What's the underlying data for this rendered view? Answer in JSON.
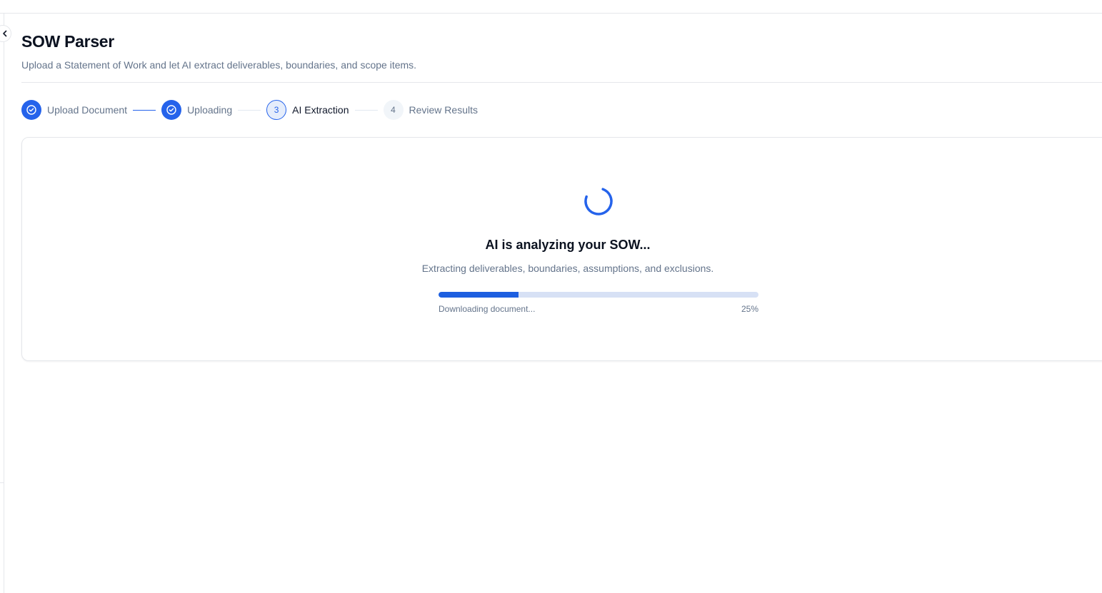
{
  "page": {
    "title": "SOW Parser",
    "subtitle": "Upload a Statement of Work and let AI extract deliverables, boundaries, and scope items."
  },
  "stepper": {
    "steps": [
      {
        "label": "Upload Document",
        "status": "completed",
        "icon": "check-circle-icon"
      },
      {
        "label": "Uploading",
        "status": "completed",
        "icon": "check-circle-icon"
      },
      {
        "number": "3",
        "label": "AI Extraction",
        "status": "active"
      },
      {
        "number": "4",
        "label": "Review Results",
        "status": "pending"
      }
    ]
  },
  "analysis": {
    "title": "AI is analyzing your SOW...",
    "subtitle": "Extracting deliverables, boundaries, assumptions, and exclusions.",
    "progress": {
      "status_text": "Downloading document...",
      "percent_label": "25%",
      "value": 0.25
    }
  },
  "sidebar": {
    "toggle_icon": "chevron-left-icon"
  },
  "colors": {
    "accent": "#2563eb",
    "progress_fill": "#1d5fe0",
    "progress_track": "#d7e1f5",
    "muted_text": "#64748b",
    "border": "#e5e7eb"
  }
}
